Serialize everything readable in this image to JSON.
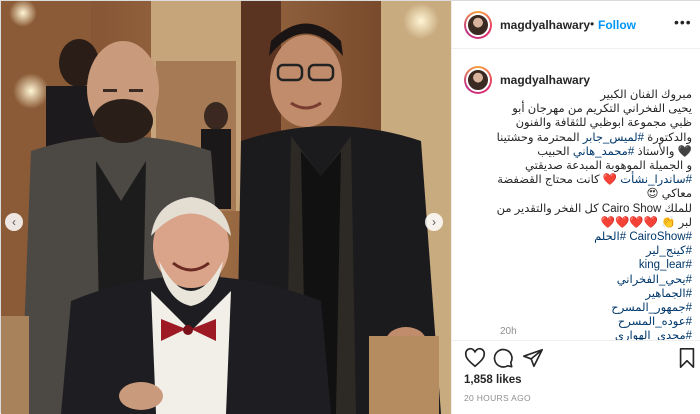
{
  "post": {
    "username": "magdyalhawary",
    "follow_label": "Follow",
    "dot": "•",
    "more_icon": "more-options-icon",
    "carousel": {
      "prev_icon": "chevron-left-icon",
      "next_icon": "chevron-right-icon"
    }
  },
  "caption": {
    "username": "magdyalhawary",
    "lines": [
      {
        "text": "مبروك الفنان الكبير"
      },
      {
        "text": "يحيى الفخراني التكريم من مهرجان أبو"
      },
      {
        "text": "ظبي مجموعة ابوظبي للثقافة والفنون"
      },
      {
        "text": "والدكتورة ",
        "tag": "#لميس_جابر",
        "after": " المحترمة وحشتينا"
      },
      {
        "text": "🖤 والأستاذ ",
        "tag": "#محمد_هاني",
        "after": " الحبيب"
      },
      {
        "text": "و الجميلة الموهوبة المبدعة صديقتي"
      },
      {
        "tag": "#ساندرا_نشأت",
        "after": " ❤️ كانت محتاج القضفضة"
      },
      {
        "text": "معاكي 😍"
      },
      {
        "text": "للملك Cairo Show كل الفخر والتقدير من"
      },
      {
        "text": "لبر 👏 ❤️❤️❤️❤️"
      },
      {
        "tag": "#CairoShow",
        "after": " ",
        "tag2": "#الحلم"
      },
      {
        "tag": "#كينج_لير"
      },
      {
        "tag": "#king_lear"
      },
      {
        "tag": "#يحي_الفخراني"
      },
      {
        "tag": "#الجماهير"
      },
      {
        "tag": "#جمهور_المسرح"
      },
      {
        "tag": "#عوده_المسرح"
      },
      {
        "tag": "#مجدي_الهواري"
      }
    ],
    "time_ago": "20h"
  },
  "actions": {
    "like_icon": "heart-icon",
    "comment_icon": "comment-icon",
    "share_icon": "share-icon",
    "save_icon": "bookmark-icon",
    "likes": "1,858 likes",
    "posted": "20 HOURS AGO"
  },
  "colors": {
    "link": "#0095f6",
    "hashtag": "#00376b",
    "muted": "#8e8e8e",
    "border": "#dbdbdb"
  }
}
